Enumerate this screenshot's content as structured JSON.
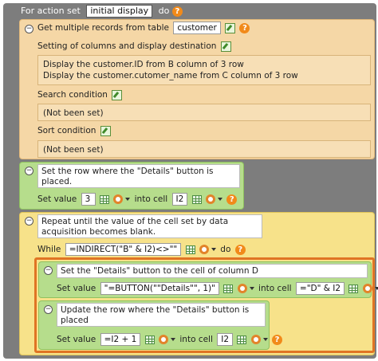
{
  "outer": {
    "prefix": "For action set",
    "action_set": "initial display",
    "suffix": "do"
  },
  "get_records": {
    "label": "Get multiple records from table",
    "table": "customer",
    "columns_label": "Setting of columns and display destination",
    "columns_lines": [
      "Display the customer.ID from B column of 3 row",
      "Display the customer.cutomer_name from C column of 3 row"
    ],
    "search_label": "Search condition",
    "search_value": "(Not been set)",
    "sort_label": "Sort condition",
    "sort_value": "(Not been set)"
  },
  "set_row": {
    "title": "Set the row where the \"Details\" button is placed.",
    "set_value_label": "Set value",
    "value": "3",
    "into_cell_label": "into cell",
    "cell": "I2"
  },
  "repeat": {
    "title": "Repeat until the value of the cell set by data acquisition becomes blank.",
    "while_label": "While",
    "condition": "=INDIRECT(\"B\" & I2)<>\"\"",
    "do_label": "do"
  },
  "set_button": {
    "title": "Set the \"Details\" button to the cell of column D",
    "set_value_label": "Set value",
    "value": "\"=BUTTON(\"\"Details\"\", 1)\"",
    "into_cell_label": "into cell",
    "cell": "=\"D\" & I2"
  },
  "update_row": {
    "title": "Update the row where the \"Details\" button is placed",
    "set_value_label": "Set value",
    "value": "=I2 + 1",
    "into_cell_label": "into cell",
    "cell": "I2"
  },
  "colors": {
    "outer": "#7d7d7d",
    "peach": "#f5d7a6",
    "green": "#b6dd8c",
    "yellow": "#f7e28a",
    "highlight": "#e07424",
    "help": "#f18a1a"
  },
  "icons": [
    "help-icon",
    "edit-icon",
    "cell-picker-icon",
    "formula-icon",
    "collapse-icon",
    "dropdown-caret-icon"
  ]
}
